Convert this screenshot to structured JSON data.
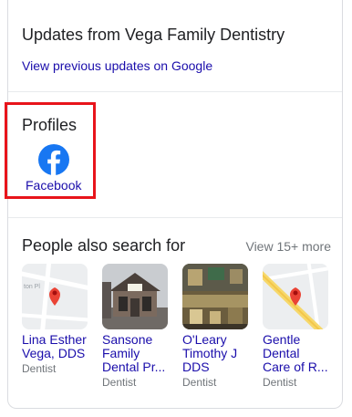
{
  "updates": {
    "title": "Updates from Vega Family Dentistry",
    "link": "View previous updates on Google"
  },
  "profiles": {
    "title": "Profiles",
    "items": [
      {
        "label": "Facebook",
        "icon": "facebook-icon",
        "color": "#1877f2"
      }
    ]
  },
  "people_also_search": {
    "title": "People also search for",
    "more": "View 15+ more",
    "items": [
      {
        "name": "Lina Esther\nVega, DDS",
        "category": "Dentist",
        "thumb": "map"
      },
      {
        "name": "Sansone\nFamily\nDental Pr...",
        "category": "Dentist",
        "thumb": "photo-building"
      },
      {
        "name": "O'Leary\nTimothy J\nDDS",
        "category": "Dentist",
        "thumb": "photo-office"
      },
      {
        "name": "Gentle\nDental\nCare of R...",
        "category": "Dentist",
        "thumb": "map-road"
      }
    ]
  },
  "colors": {
    "link": "#1a0dab",
    "map_pin": "#ea4335",
    "highlight_box": "#e8141b"
  }
}
